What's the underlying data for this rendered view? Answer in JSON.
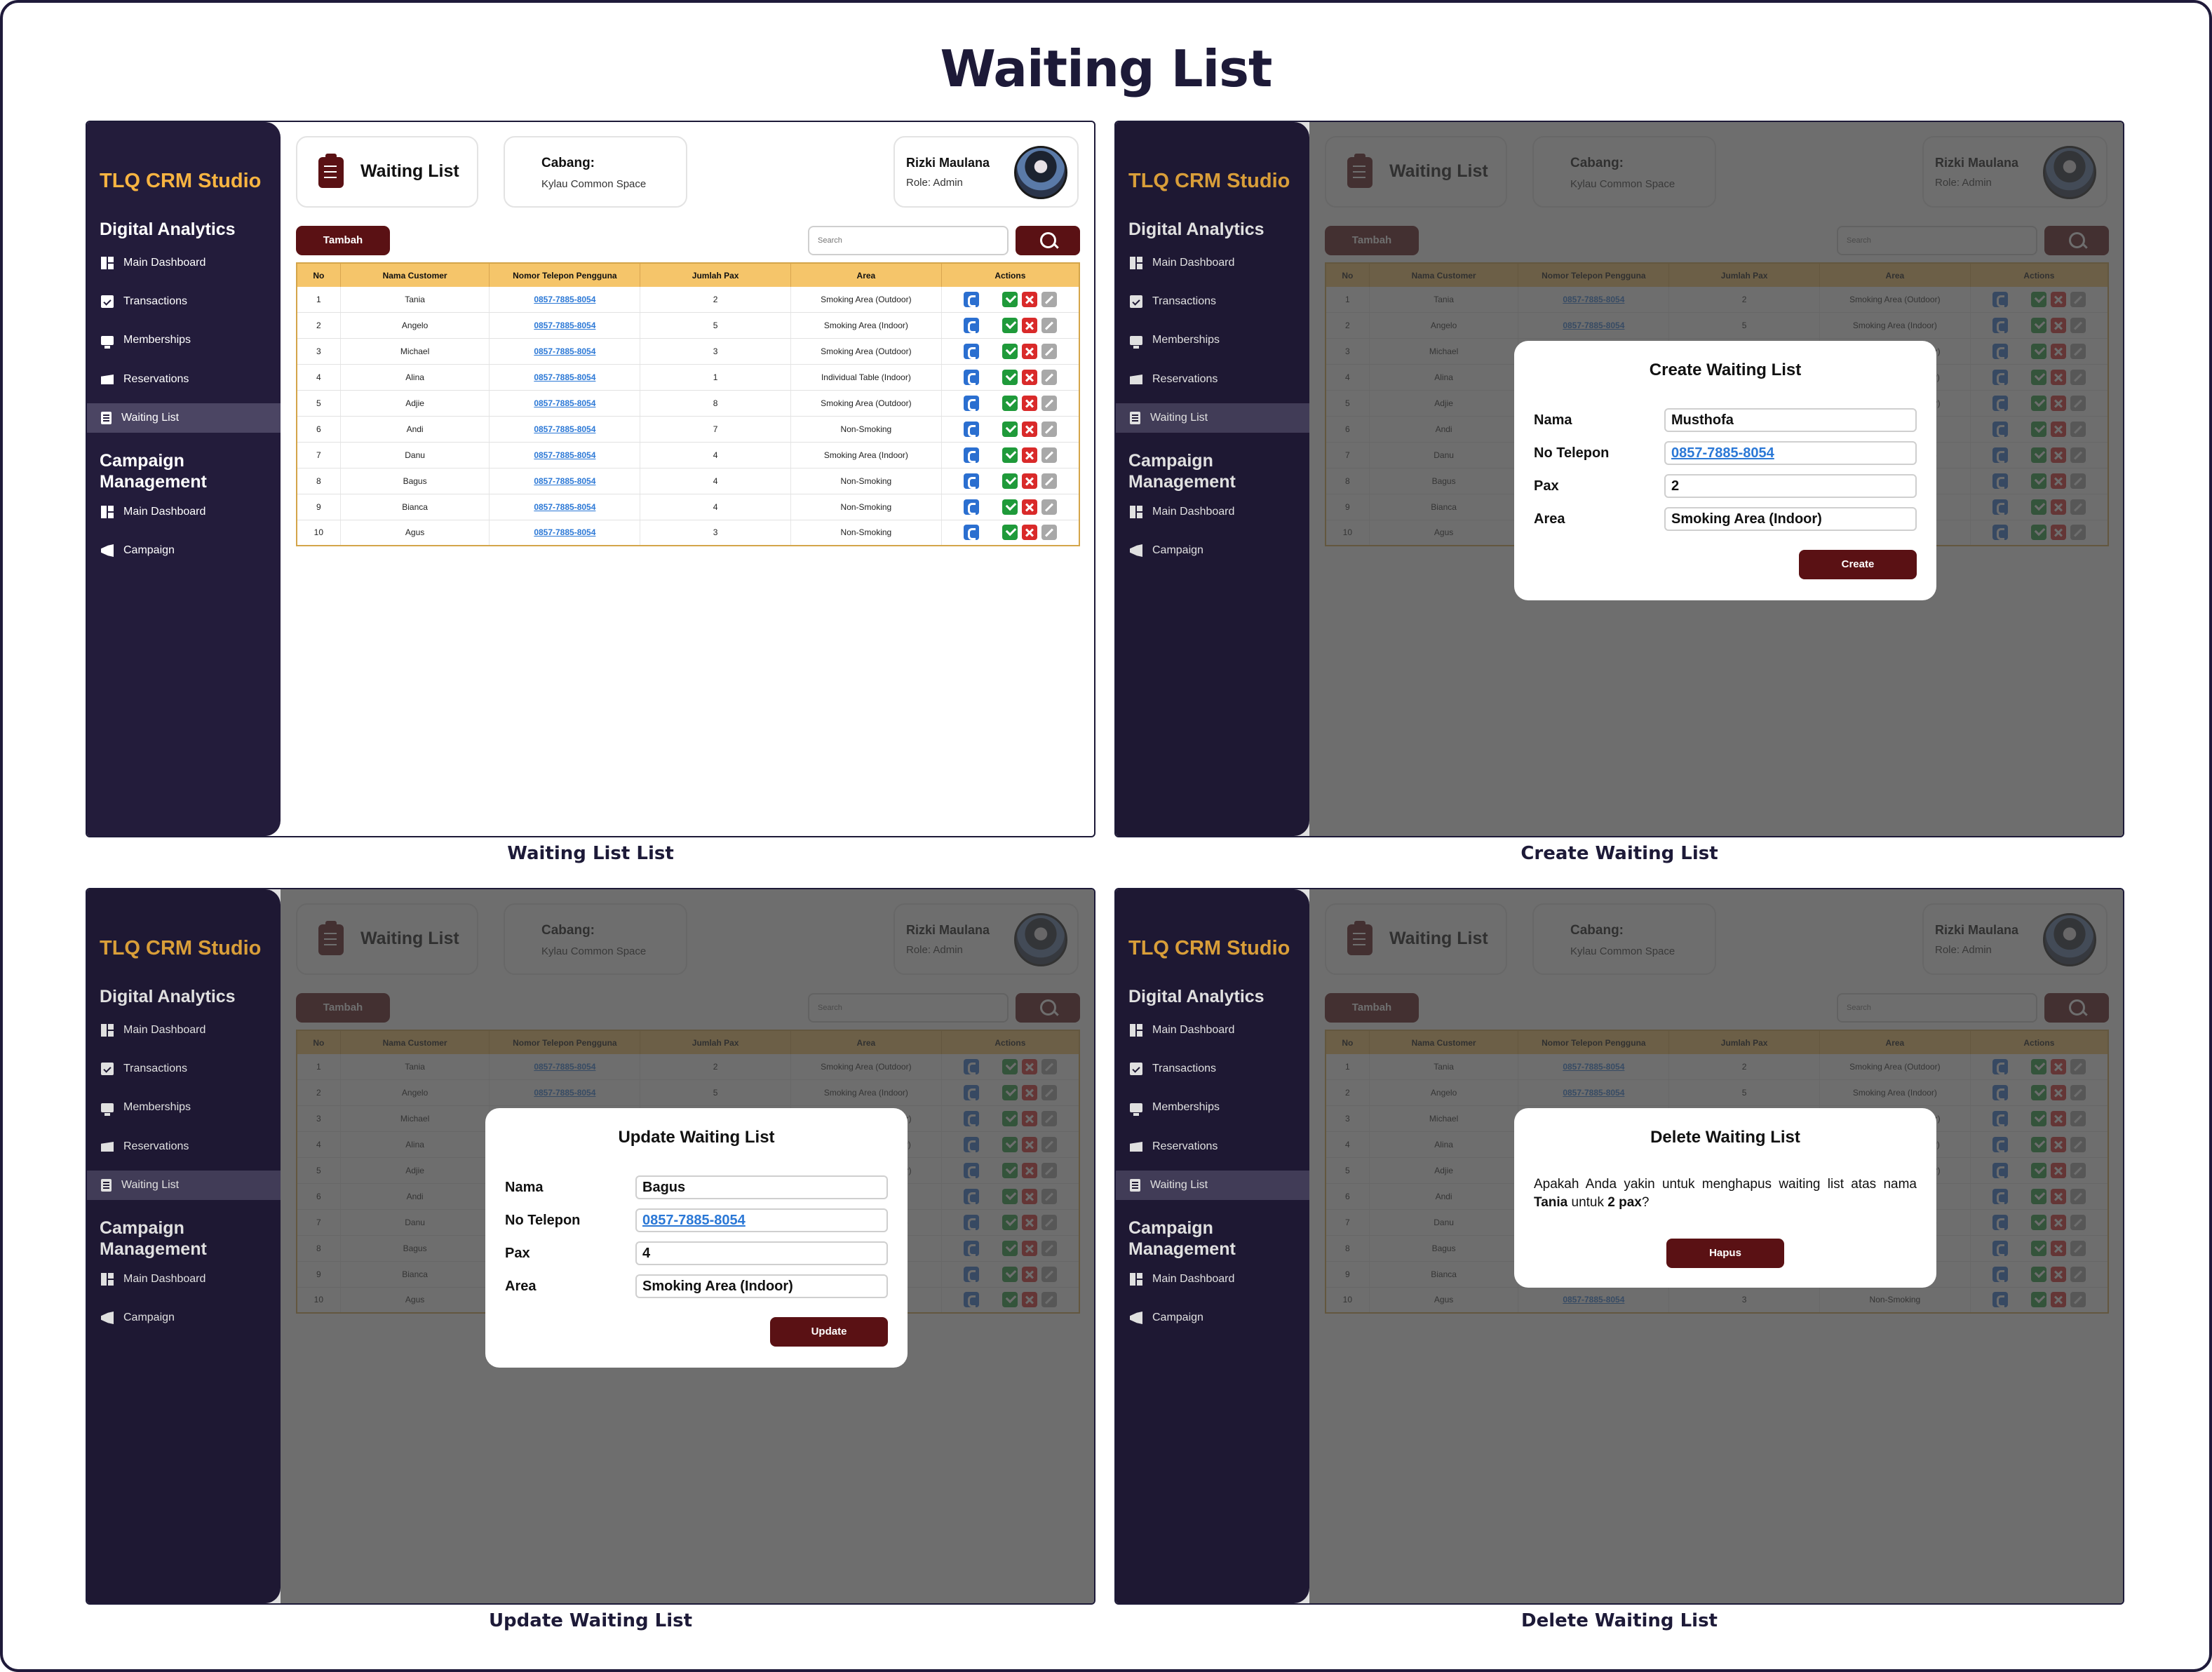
{
  "page_title": "Waiting List",
  "captions": [
    "Waiting List List",
    "Create Waiting List",
    "Update Waiting List",
    "Delete Waiting List"
  ],
  "sidebar": {
    "brand": "TLQ CRM Studio",
    "section1": "Digital Analytics",
    "section1_items": [
      "Main Dashboard",
      "Transactions",
      "Memberships",
      "Reservations",
      "Waiting List"
    ],
    "section2": "Campaign Management",
    "section2_items": [
      "Main Dashboard",
      "Campaign"
    ],
    "active_item": "Waiting List"
  },
  "header": {
    "title": "Waiting List",
    "branch_label": "Cabang:",
    "branch_value": "Kylau Common Space",
    "user_name": "Rizki Maulana",
    "user_role": "Role: Admin"
  },
  "toolbar": {
    "add_label": "Tambah",
    "search_placeholder": "Search"
  },
  "table": {
    "columns": [
      "No",
      "Nama Customer",
      "Nomor Telepon Pengguna",
      "Jumlah Pax",
      "Area",
      "Actions"
    ],
    "rows": [
      [
        "1",
        "Tania",
        "0857-7885-8054",
        "2",
        "Smoking Area (Outdoor)"
      ],
      [
        "2",
        "Angelo",
        "0857-7885-8054",
        "5",
        "Smoking Area (Indoor)"
      ],
      [
        "3",
        "Michael",
        "0857-7885-8054",
        "3",
        "Smoking Area (Outdoor)"
      ],
      [
        "4",
        "Alina",
        "0857-7885-8054",
        "1",
        "Individual Table (Indoor)"
      ],
      [
        "5",
        "Adjie",
        "0857-7885-8054",
        "8",
        "Smoking Area (Outdoor)"
      ],
      [
        "6",
        "Andi",
        "0857-7885-8054",
        "7",
        "Non-Smoking"
      ],
      [
        "7",
        "Danu",
        "0857-7885-8054",
        "4",
        "Smoking Area (Indoor)"
      ],
      [
        "8",
        "Bagus",
        "0857-7885-8054",
        "4",
        "Non-Smoking"
      ],
      [
        "9",
        "Bianca",
        "0857-7885-8054",
        "4",
        "Non-Smoking"
      ],
      [
        "10",
        "Agus",
        "0857-7885-8054",
        "3",
        "Non-Smoking"
      ]
    ]
  },
  "labels": {
    "nama": "Nama",
    "telepon": "No Telepon",
    "pax": "Pax",
    "area": "Area"
  },
  "create_modal": {
    "title": "Create Waiting List",
    "nama": "Musthofa",
    "telepon": "0857-7885-8054",
    "pax": "2",
    "area": "Smoking Area (Indoor)",
    "button": "Create"
  },
  "update_modal": {
    "title": "Update Waiting List",
    "nama": "Bagus",
    "telepon": "0857-7885-8054",
    "pax": "4",
    "area": "Smoking Area (Indoor)",
    "button": "Update"
  },
  "delete_modal": {
    "title": "Delete Waiting List",
    "text_before": "Apakah Anda yakin untuk menghapus waiting list atas nama ",
    "name": "Tania",
    "text_middle": " untuk ",
    "pax": "2 pax",
    "text_after": "?",
    "button": "Hapus"
  },
  "colors": {
    "sidebar": "#231c3b",
    "brand": "#f7b441",
    "primary": "#5a1114",
    "table_header": "#f5c56a",
    "phone_link": "#2b78d6"
  }
}
